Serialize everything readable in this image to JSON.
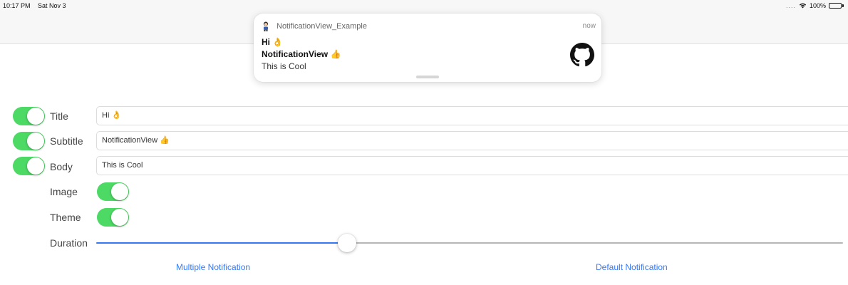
{
  "status_bar": {
    "time": "10:17 PM",
    "date": "Sat Nov 3",
    "signal": "....",
    "battery": "100%",
    "icons": [
      "wifi-icon",
      "battery-icon"
    ]
  },
  "notification": {
    "app_name": "NotificationView_Example",
    "time": "now",
    "title": "Hi 👌",
    "subtitle": "NotificationView 👍",
    "body": "This is Cool",
    "image_icon": "github-icon",
    "app_icon": "character-icon"
  },
  "form": {
    "rows": [
      {
        "label": "Title",
        "switch_on": true,
        "value": "Hi 👌"
      },
      {
        "label": "Subtitle",
        "switch_on": true,
        "value": "NotificationView 👍"
      },
      {
        "label": "Body",
        "switch_on": true,
        "value": "This is Cool"
      }
    ],
    "image": {
      "label": "Image",
      "switch_on": true
    },
    "theme": {
      "label": "Theme",
      "switch_on": true
    },
    "duration": {
      "label": "Duration",
      "fraction": 0.336
    }
  },
  "actions": {
    "multiple": "Multiple Notification",
    "default": "Default Notification"
  },
  "colors": {
    "switch_on": "#4cd964",
    "tint": "#3478f6",
    "slider_max": "#b6b6b6"
  }
}
